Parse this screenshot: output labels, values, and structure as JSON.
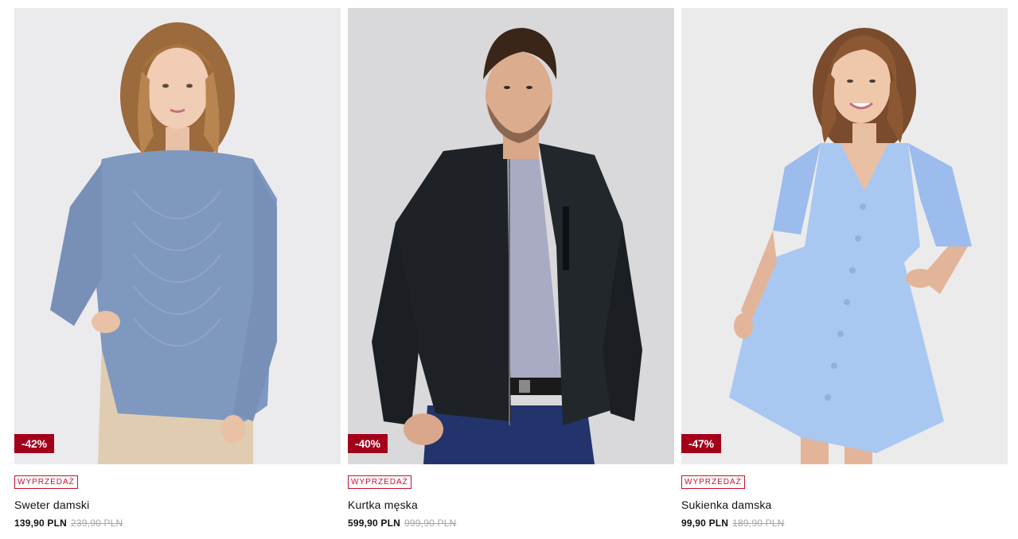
{
  "products": [
    {
      "discount": "-42%",
      "sale_label": "WYPRZEDAŻ",
      "name": "Sweter damski",
      "price": "139,90 PLN",
      "old_price": "239,90 PLN",
      "image_alt": "woman-in-blue-knit-sweater"
    },
    {
      "discount": "-40%",
      "sale_label": "WYPRZEDAŻ",
      "name": "Kurtka męska",
      "price": "599,90 PLN",
      "old_price": "999,90 PLN",
      "image_alt": "man-in-black-leather-jacket"
    },
    {
      "discount": "-47%",
      "sale_label": "WYPRZEDAŻ",
      "name": "Sukienka damska",
      "price": "99,90 PLN",
      "old_price": "189,90 PLN",
      "image_alt": "woman-in-light-blue-dress"
    }
  ],
  "colors": {
    "discount_badge": "#a3001b",
    "sale_label": "#c4122f",
    "old_price": "#a6a6a6"
  }
}
